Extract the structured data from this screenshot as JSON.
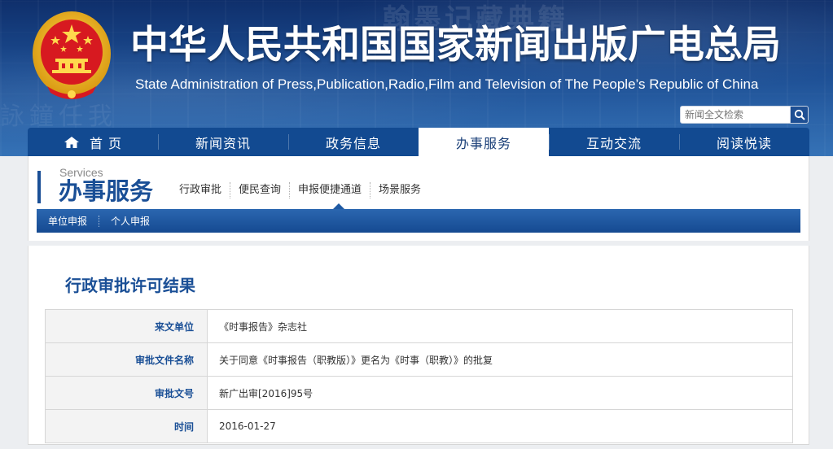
{
  "header": {
    "title_zh": "中华人民共和国国家新闻出版广电总局",
    "title_en": "State Administration of Press,Publication,Radio,Film and Television of The People’s Republic of China",
    "search_placeholder": "新闻全文检索",
    "background_chars": "翰墨记藏典籍",
    "background_chars2": "詠鐘任我"
  },
  "nav": {
    "items": [
      {
        "label": "首 页",
        "icon": "home-icon"
      },
      {
        "label": "新闻资讯"
      },
      {
        "label": "政务信息"
      },
      {
        "label": "办事服务",
        "active": true
      },
      {
        "label": "互动交流"
      },
      {
        "label": "阅读悦读"
      }
    ]
  },
  "section": {
    "en": "Services",
    "zh": "办事服务",
    "tabs": [
      "行政审批",
      "便民查询",
      "申报便捷通道",
      "场景服务"
    ],
    "active_tab": "申报便捷通道",
    "subnav": [
      "单位申报",
      "个人申报"
    ]
  },
  "content": {
    "title": "行政审批许可结果",
    "rows": [
      {
        "label": "来文单位",
        "value": "《时事报告》杂志社"
      },
      {
        "label": "审批文件名称",
        "value": "关于同意《时事报告（职教版）》更名为《时事（职教）》的批复"
      },
      {
        "label": "审批文号",
        "value": "新广出审[2016]95号"
      },
      {
        "label": "时间",
        "value": "2016-01-27"
      }
    ]
  },
  "colors": {
    "brand_blue": "#1a4f96",
    "nav_blue": "#124a91",
    "emblem_red": "#d71920",
    "emblem_gold": "#f3c530"
  }
}
